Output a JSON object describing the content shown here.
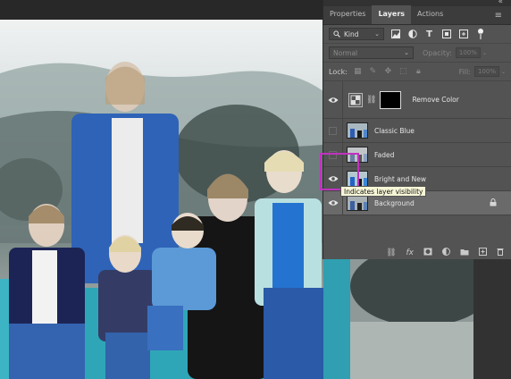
{
  "panel": {
    "collapse_glyph": "«",
    "menu_glyph": "≡",
    "tabs": [
      {
        "label": "Properties"
      },
      {
        "label": "Layers"
      },
      {
        "label": "Actions"
      }
    ],
    "filter": {
      "value": "Kind",
      "icons": [
        "image-filter-icon",
        "adjustment-filter-icon",
        "type-filter-icon",
        "shape-filter-icon",
        "smart-object-filter-icon",
        "filter-toggle-icon"
      ]
    },
    "blend_mode": "Normal",
    "opacity_label": "Opacity:",
    "opacity_value": "100%",
    "lock_label": "Lock:",
    "fill_label": "Fill:",
    "fill_value": "100%",
    "layers": [
      {
        "name": "Remove Color",
        "visible": true,
        "type": "adjustment"
      },
      {
        "name": "Classic Blue",
        "visible": false
      },
      {
        "name": "Faded",
        "visible": false
      },
      {
        "name": "Bright and New",
        "visible": true
      },
      {
        "name": "Background",
        "visible": true,
        "locked": true,
        "selected": true
      }
    ],
    "tooltip": "Indicates layer visibility"
  },
  "colors": {
    "highlight": "#c032c0",
    "panel_bg": "#535353",
    "selected_row": "#6a6a6a"
  }
}
